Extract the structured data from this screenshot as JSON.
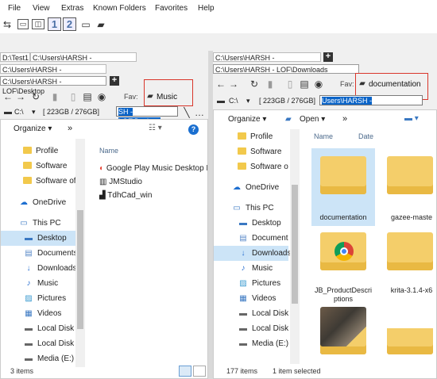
{
  "menu": [
    "File",
    "View",
    "Extras",
    "Known Folders",
    "Favorites",
    "Help"
  ],
  "toolbar": {
    "pane1": "1",
    "pane2": "2"
  },
  "left": {
    "tabs": [
      "D:\\Test1",
      "C:\\Users\\HARSH - LOF\\Desktop",
      "C:\\Users\\HARSH - LOF\\Desktop",
      "C:\\Users\\HARSH - LOF\\Desktop"
    ],
    "fav_label": "Fav:",
    "fav_item": "Music",
    "drive": "C:\\",
    "drive_arrow": "▾",
    "space": "[ 223GB / 276GB]",
    "path": "SH - LOF\\Desktop",
    "organize": "Organize ▾",
    "more": "»",
    "nav": [
      "Profile",
      "Software",
      "Software of",
      "OneDrive",
      "This PC",
      "Desktop",
      "Documents",
      "Downloads",
      "Music",
      "Pictures",
      "Videos",
      "Local Disk (",
      "Local Disk (",
      "Media (E:)"
    ],
    "col_name": "Name",
    "files": [
      "Google Play Music Desktop P",
      "JMStudio",
      "TdhCad_win"
    ],
    "status": "3 items"
  },
  "right": {
    "tab_path1": "C:\\Users\\HARSH - LOF\\Desktop",
    "tab_path2": "C:\\Users\\HARSH - LOF\\Downloads",
    "fav_label": "Fav:",
    "fav_item": "documentation",
    "drive": "C:\\",
    "drive_arrow": "▾",
    "space": "[ 223GB / 276GB]",
    "path": "Users\\HARSH - LOF\\Downloads",
    "organize": "Organize ▾",
    "open": "Open ▾",
    "more": "»",
    "nav": [
      "Profile",
      "Software",
      "Software of",
      "OneDrive",
      "This PC",
      "Desktop",
      "Documents",
      "Downloads",
      "Music",
      "Pictures",
      "Videos",
      "Local Disk (",
      "Local Disk (",
      "Media (E:)"
    ],
    "col_name": "Name",
    "col_date": "Date",
    "tiles": [
      "documentation",
      "gazee-maste",
      "JB_ProductDescri ptions",
      "krita-3.1.4-x6"
    ],
    "status_count": "177 items",
    "status_sel": "1 item selected"
  }
}
